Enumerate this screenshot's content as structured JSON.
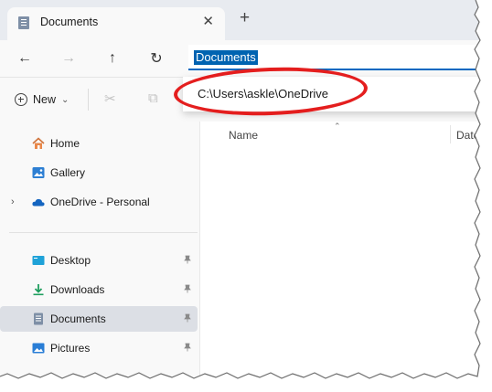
{
  "tab": {
    "title": "Documents",
    "close_glyph": "✕",
    "new_tab_glyph": "+"
  },
  "nav": {
    "back_glyph": "←",
    "forward_glyph": "→",
    "up_glyph": "↑",
    "refresh_glyph": "↻"
  },
  "address": {
    "value": "Documents"
  },
  "dropdown": {
    "suggestion": "C:\\Users\\askle\\OneDrive"
  },
  "toolbar": {
    "new_label": "New",
    "new_caret": "⌄",
    "cut_glyph": "✂",
    "copy_glyph": "⧉"
  },
  "columns": {
    "name": "Name",
    "date": "Date",
    "sort_glyph": "⌃"
  },
  "sidebar": {
    "items": [
      {
        "label": "Home",
        "icon": "home-icon"
      },
      {
        "label": "Gallery",
        "icon": "gallery-icon"
      },
      {
        "label": "OneDrive - Personal",
        "icon": "cloud-icon",
        "chevron": "›"
      },
      {
        "label": "Desktop",
        "icon": "desktop-icon",
        "pinned": true
      },
      {
        "label": "Downloads",
        "icon": "download-icon",
        "pinned": true
      },
      {
        "label": "Documents",
        "icon": "document-icon",
        "pinned": true,
        "selected": true
      },
      {
        "label": "Pictures",
        "icon": "pictures-icon",
        "pinned": true
      }
    ],
    "pin_glyph": "📌"
  },
  "colors": {
    "accent": "#0067c0",
    "selection": "#0063b1",
    "highlight_ellipse": "#e41e1e"
  }
}
